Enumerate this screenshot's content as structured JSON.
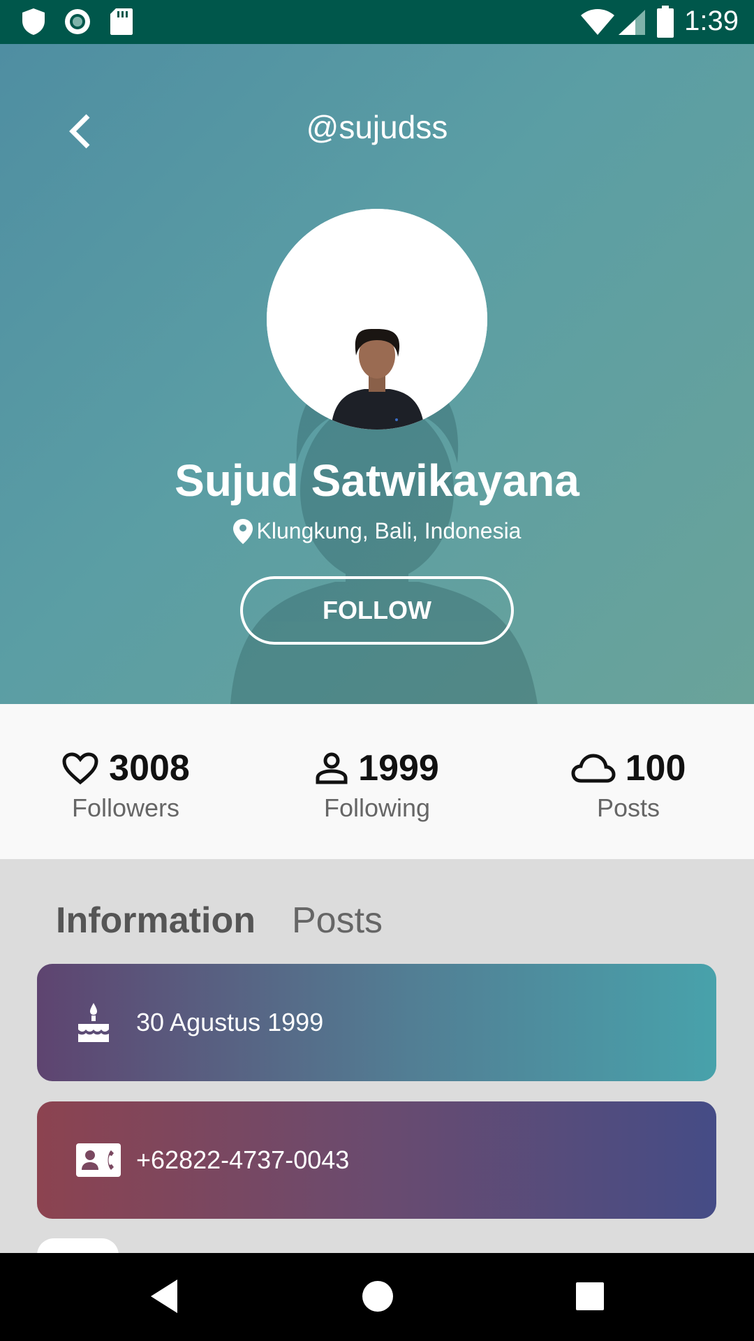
{
  "status_bar": {
    "time": "1:39",
    "left_icons": [
      "shield-icon",
      "sync-icon",
      "sd-card-icon"
    ],
    "right_icons": [
      "wifi-icon",
      "signal-icon",
      "battery-icon"
    ]
  },
  "header": {
    "back_icon": "chevron-left-icon",
    "username": "@sujudss",
    "name": "Sujud Satwikayana",
    "location": "Klungkung, Bali, Indonesia",
    "location_icon": "location-pin-icon",
    "follow_label": "FOLLOW"
  },
  "stats": [
    {
      "icon": "heart-icon",
      "value": "3008",
      "label": "Followers"
    },
    {
      "icon": "person-icon",
      "value": "1999",
      "label": "Following"
    },
    {
      "icon": "cloud-icon",
      "value": "100",
      "label": "Posts"
    }
  ],
  "tabs": [
    {
      "label": "Information",
      "active": true
    },
    {
      "label": "Posts",
      "active": false
    }
  ],
  "info_cards": [
    {
      "icon": "cake-icon",
      "text": "30 Agustus 1999"
    },
    {
      "icon": "contact-phone-icon",
      "text": "+62822-4737-0043"
    }
  ],
  "nav_bar": {
    "buttons": [
      "back-triangle-icon",
      "home-circle-icon",
      "recents-square-icon"
    ]
  }
}
